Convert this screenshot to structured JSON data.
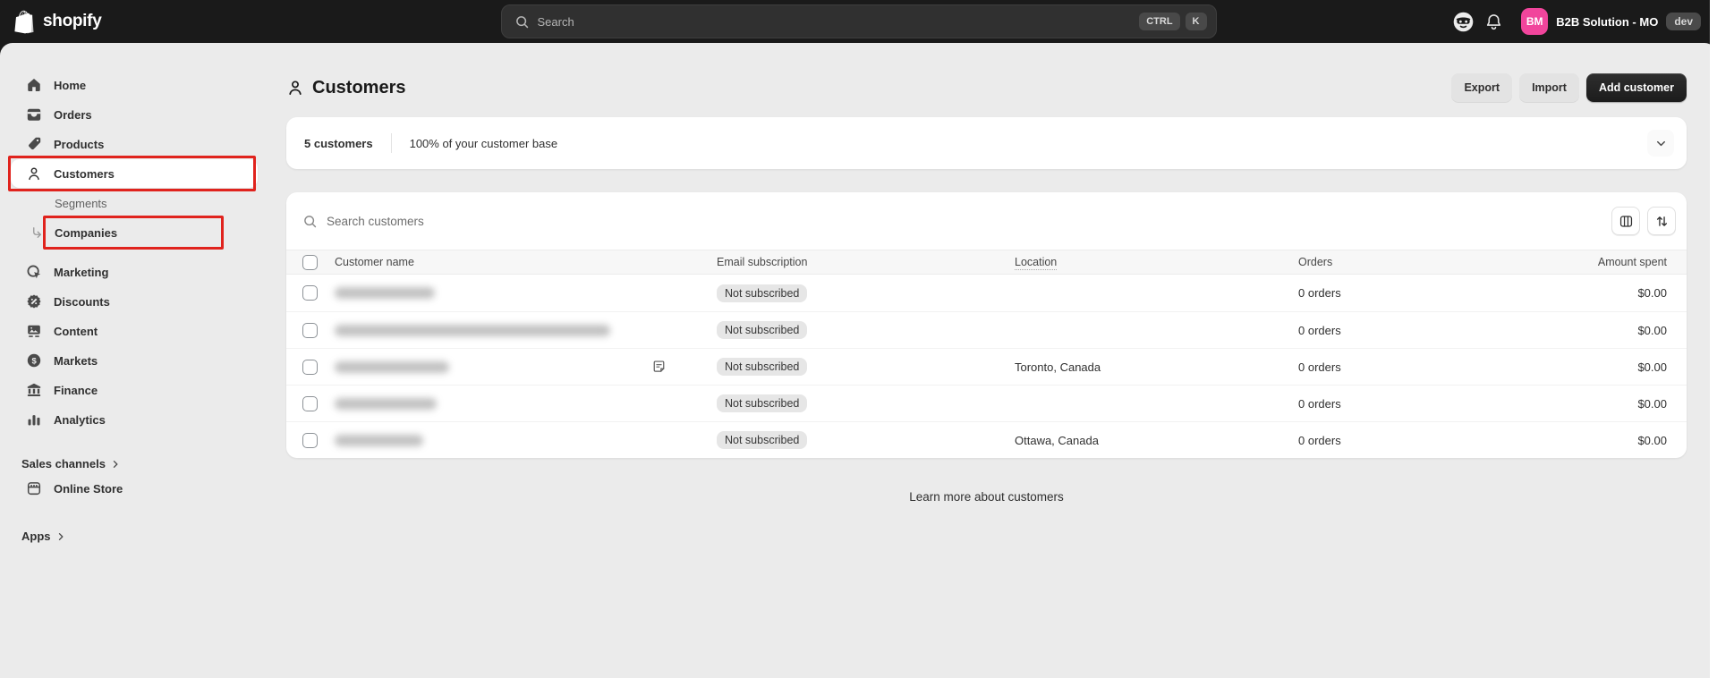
{
  "topbar": {
    "logo_text": "shopify",
    "search": {
      "placeholder": "Search",
      "shortcut": [
        "CTRL",
        "K"
      ]
    },
    "store": {
      "initials": "BM",
      "name": "B2B Solution - MO",
      "badge": "dev"
    }
  },
  "sidebar": {
    "items": [
      {
        "label": "Home"
      },
      {
        "label": "Orders"
      },
      {
        "label": "Products"
      },
      {
        "label": "Customers"
      },
      {
        "label": "Segments"
      },
      {
        "label": "Companies"
      },
      {
        "label": "Marketing"
      },
      {
        "label": "Discounts"
      },
      {
        "label": "Content"
      },
      {
        "label": "Markets"
      },
      {
        "label": "Finance"
      },
      {
        "label": "Analytics"
      }
    ],
    "sales_channels": "Sales channels",
    "online_store": "Online Store",
    "apps": "Apps"
  },
  "page": {
    "title": "Customers",
    "actions": {
      "export": "Export",
      "import": "Import",
      "add_customer": "Add customer"
    }
  },
  "summary": {
    "count": "5 customers",
    "base": "100% of your customer base"
  },
  "table": {
    "search_placeholder": "Search customers",
    "columns": [
      "Customer name",
      "Email subscription",
      "Location",
      "Orders",
      "Amount spent"
    ],
    "rows": [
      {
        "name_redacted": true,
        "blur_width": 112,
        "has_note": false,
        "email_subscription": "Not subscribed",
        "location": "",
        "orders": "0 orders",
        "amount_spent": "$0.00"
      },
      {
        "name_redacted": true,
        "blur_width": 308,
        "has_note": false,
        "email_subscription": "Not subscribed",
        "location": "",
        "orders": "0 orders",
        "amount_spent": "$0.00"
      },
      {
        "name_redacted": true,
        "blur_width": 128,
        "has_note": true,
        "email_subscription": "Not subscribed",
        "location": "Toronto, Canada",
        "orders": "0 orders",
        "amount_spent": "$0.00"
      },
      {
        "name_redacted": true,
        "blur_width": 114,
        "has_note": false,
        "email_subscription": "Not subscribed",
        "location": "",
        "orders": "0 orders",
        "amount_spent": "$0.00"
      },
      {
        "name_redacted": true,
        "blur_width": 99,
        "has_note": false,
        "email_subscription": "Not subscribed",
        "location": "Ottawa, Canada",
        "orders": "0 orders",
        "amount_spent": "$0.00"
      }
    ]
  },
  "footer": {
    "learn_more": "Learn more about customers"
  },
  "colors": {
    "avatar": "#f1459c",
    "annotation": "#e0231d",
    "topbar": "#1a1a1a",
    "surface": "#ebebeb"
  }
}
